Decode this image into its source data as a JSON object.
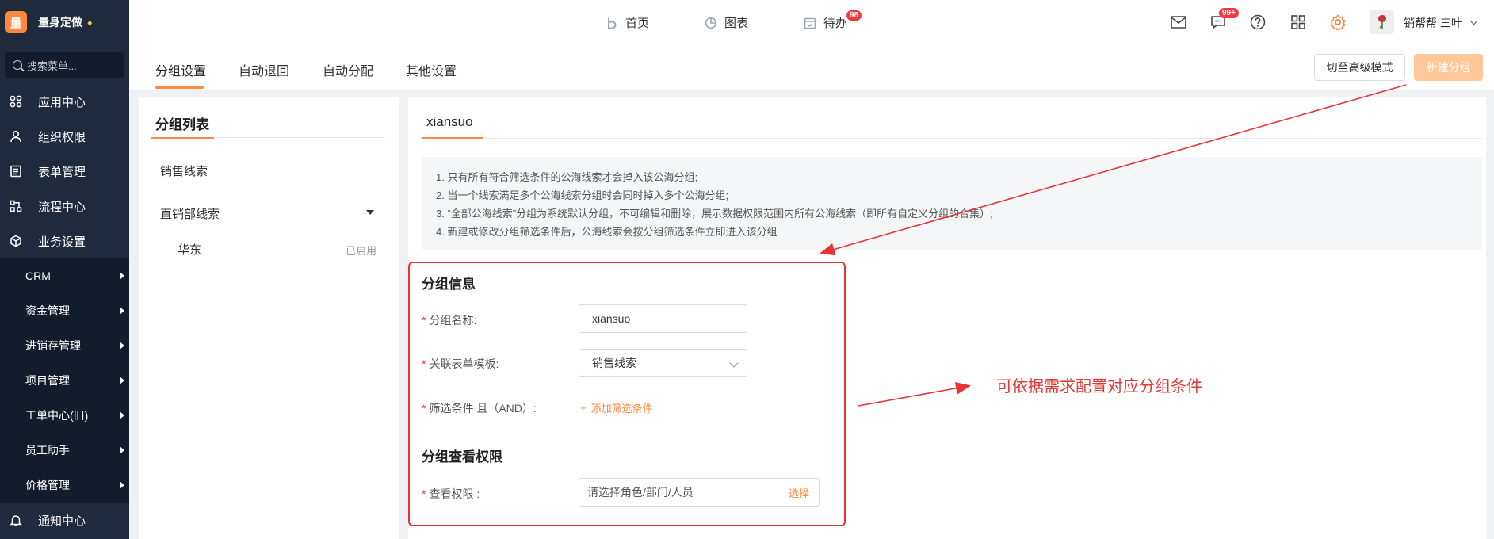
{
  "sidebar": {
    "logo_char": "量",
    "brand_name": "量身定做",
    "gem_icon": "♦",
    "search_placeholder": "搜索菜单...",
    "menu": [
      {
        "label": "应用中心",
        "icon": "apps-icon"
      },
      {
        "label": "组织权限",
        "icon": "user-icon"
      },
      {
        "label": "表单管理",
        "icon": "form-icon"
      },
      {
        "label": "流程中心",
        "icon": "flow-icon"
      },
      {
        "label": "业务设置",
        "icon": "cube-icon"
      }
    ],
    "submenu": [
      "CRM",
      "资金管理",
      "进销存管理",
      "项目管理",
      "工单中心(旧)",
      "员工助手",
      "价格管理"
    ],
    "bottom_item": {
      "label": "通知中心",
      "icon": "bell-icon"
    }
  },
  "topnav": {
    "items": [
      {
        "label": "首页",
        "icon": "home-icon"
      },
      {
        "label": "图表",
        "icon": "chart-icon"
      },
      {
        "label": "待办",
        "icon": "calendar-icon",
        "badge": "98"
      }
    ],
    "message_badge": "99+",
    "user_name": "销帮帮 三叶"
  },
  "tabs": [
    "分组设置",
    "自动退回",
    "自动分配",
    "其他设置"
  ],
  "buttons": {
    "advanced_mode": "切至高级模式",
    "new_group": "新建分组"
  },
  "group_panel": {
    "title": "分组列表",
    "items": [
      "销售线索",
      "直销部线索"
    ],
    "child": {
      "label": "华东",
      "status": "已启用"
    }
  },
  "main": {
    "tab": "xiansuo",
    "notes": [
      "1. 只有所有符合筛选条件的公海线索才会掉入该公海分组;",
      "2. 当一个线索满足多个公海线索分组时会同时掉入多个公海分组;",
      "3. “全部公海线索”分组为系统默认分组，不可编辑和删除，展示数据权限范围内所有公海线索（即所有自定义分组的合集）;",
      "4. 新建或修改分组筛选条件后，公海线索会按分组筛选条件立即进入该分组"
    ],
    "group_info_title": "分组信息",
    "required_mark": "*",
    "fields": {
      "name_label": "分组名称:",
      "name_value": "xiansuo",
      "template_label": "关联表单模板:",
      "template_value": "销售线索",
      "filter_label": "筛选条件 且（AND）:",
      "add_filter": "添加筛选条件",
      "add_filter_icon": "+"
    },
    "permission_title": "分组查看权限",
    "permission": {
      "label": "查看权限 :",
      "placeholder": "请选择角色/部门/人员",
      "select": "选择"
    }
  },
  "annotation": "可依据需求配置对应分组条件",
  "colors": {
    "accent": "#ff8a3d",
    "sidebar": "#1f2a3d",
    "annotation": "#e53535"
  }
}
